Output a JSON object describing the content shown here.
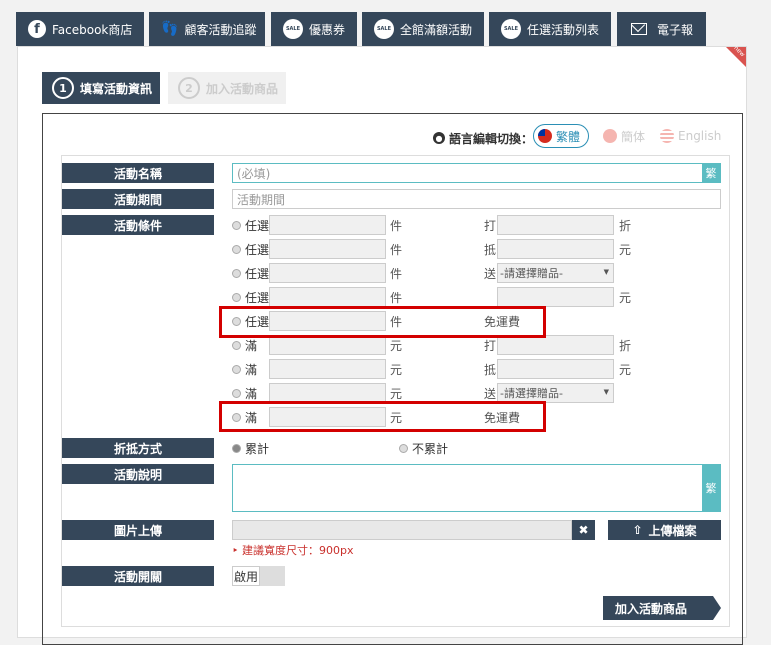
{
  "tabs": [
    {
      "label": "Facebook商店",
      "icon": "facebook-icon"
    },
    {
      "label": "顧客活動追蹤",
      "icon": "footprint-icon"
    },
    {
      "label": "優惠券",
      "icon": "sale-icon"
    },
    {
      "label": "全館滿額活動",
      "icon": "sale-icon"
    },
    {
      "label": "任選活動列表",
      "icon": "sale-icon"
    },
    {
      "label": "電子報",
      "icon": "mail-icon"
    }
  ],
  "ribbon": "new",
  "steps": [
    {
      "num": "1",
      "label": "填寫活動資訊"
    },
    {
      "num": "2",
      "label": "加入活動商品"
    }
  ],
  "lang": {
    "label": "語言編輯切換：",
    "zh_tw": "繁體",
    "zh_cn": "簡体",
    "en": "English"
  },
  "form": {
    "name_label": "活動名稱",
    "name_placeholder": "(必填)",
    "trad_tag": "繁",
    "period_label": "活動期間",
    "period_placeholder": "活動期間",
    "cond_label": "活動條件",
    "unit_piece": "件",
    "unit_yuan": "元",
    "pick_any": "任選",
    "full": "滿",
    "k_discount": "打",
    "k_off": "折",
    "k_deduct": "抵",
    "k_gift": "送",
    "gift_select": "-請選擇贈品-",
    "free_shipping": "免運費",
    "stack_label": "折抵方式",
    "stack_yes": "累計",
    "stack_no": "不累計",
    "desc_label": "活動說明",
    "image_label": "圖片上傳",
    "upload_button": "上傳檔案",
    "clear_icon_text": "✖",
    "hint": "‣ 建議寬度尺寸：900px",
    "switch_label": "活動開關",
    "switch_value": "啟用"
  },
  "add_button": "加入活動商品"
}
